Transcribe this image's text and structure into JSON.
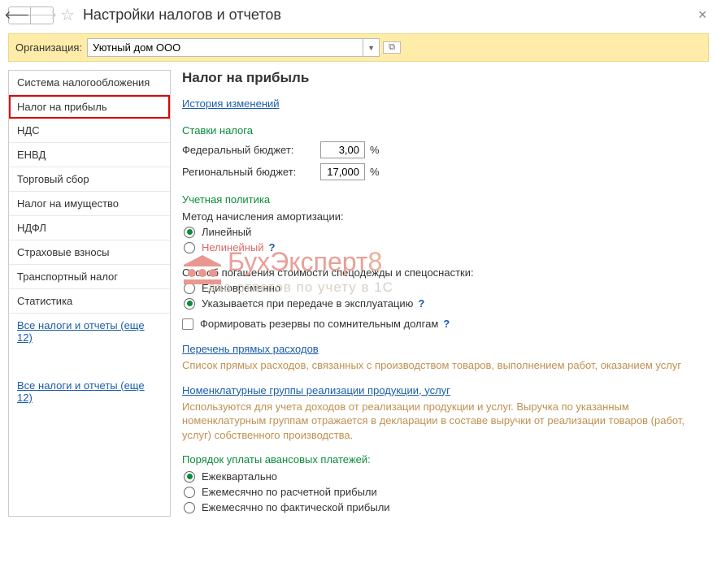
{
  "window": {
    "title": "Настройки налогов и отчетов"
  },
  "org": {
    "label": "Организация:",
    "value": "Уютный дом ООО"
  },
  "sidebar": {
    "items": [
      "Система налогообложения",
      "Налог на прибыль",
      "НДС",
      "ЕНВД",
      "Торговый сбор",
      "Налог на имущество",
      "НДФЛ",
      "Страховые взносы",
      "Транспортный налог",
      "Статистика"
    ],
    "link": "Все налоги и отчеты (еще 12)"
  },
  "main": {
    "heading": "Налог на прибыль",
    "history": "История изменений",
    "rates": {
      "title": "Ставки налога",
      "federal_label": "Федеральный бюджет:",
      "federal_value": "3,00",
      "regional_label": "Региональный бюджет:",
      "regional_value": "17,000",
      "pct": "%"
    },
    "policy": {
      "title": "Учетная политика",
      "amort_label": "Метод начисления амортизации:",
      "amort_linear": "Линейный",
      "amort_nonlinear": "Нелинейный",
      "work_label": "Способ погашения стоимости спецодежды и спецоснастки:",
      "work_once": "Единовременно",
      "work_transfer": "Указывается при передаче в эксплуатацию",
      "reserve": "Формировать резервы по сомнительным долгам",
      "help": "?"
    },
    "direct": {
      "link": "Перечень прямых расходов",
      "desc": "Список прямых расходов, связанных с производством товаров, выполнением работ, оказанием услуг"
    },
    "nomen": {
      "link": "Номенклатурные группы реализации продукции, услуг",
      "desc": "Используются для учета доходов от реализации продукции и услуг. Выручка по указанным номенклатурным группам отражается в декларации в составе выручки от реализации товаров (работ, услуг) собственного производства."
    },
    "advance": {
      "title": "Порядок уплаты авансовых платежей:",
      "q": "Ежеквартально",
      "m_calc": "Ежемесячно по расчетной прибыли",
      "m_fact": "Ежемесячно по фактической прибыли"
    }
  },
  "watermark": {
    "brand": "БухЭксперт",
    "eight": "8",
    "sub": "аза ответов по учету в 1С"
  }
}
